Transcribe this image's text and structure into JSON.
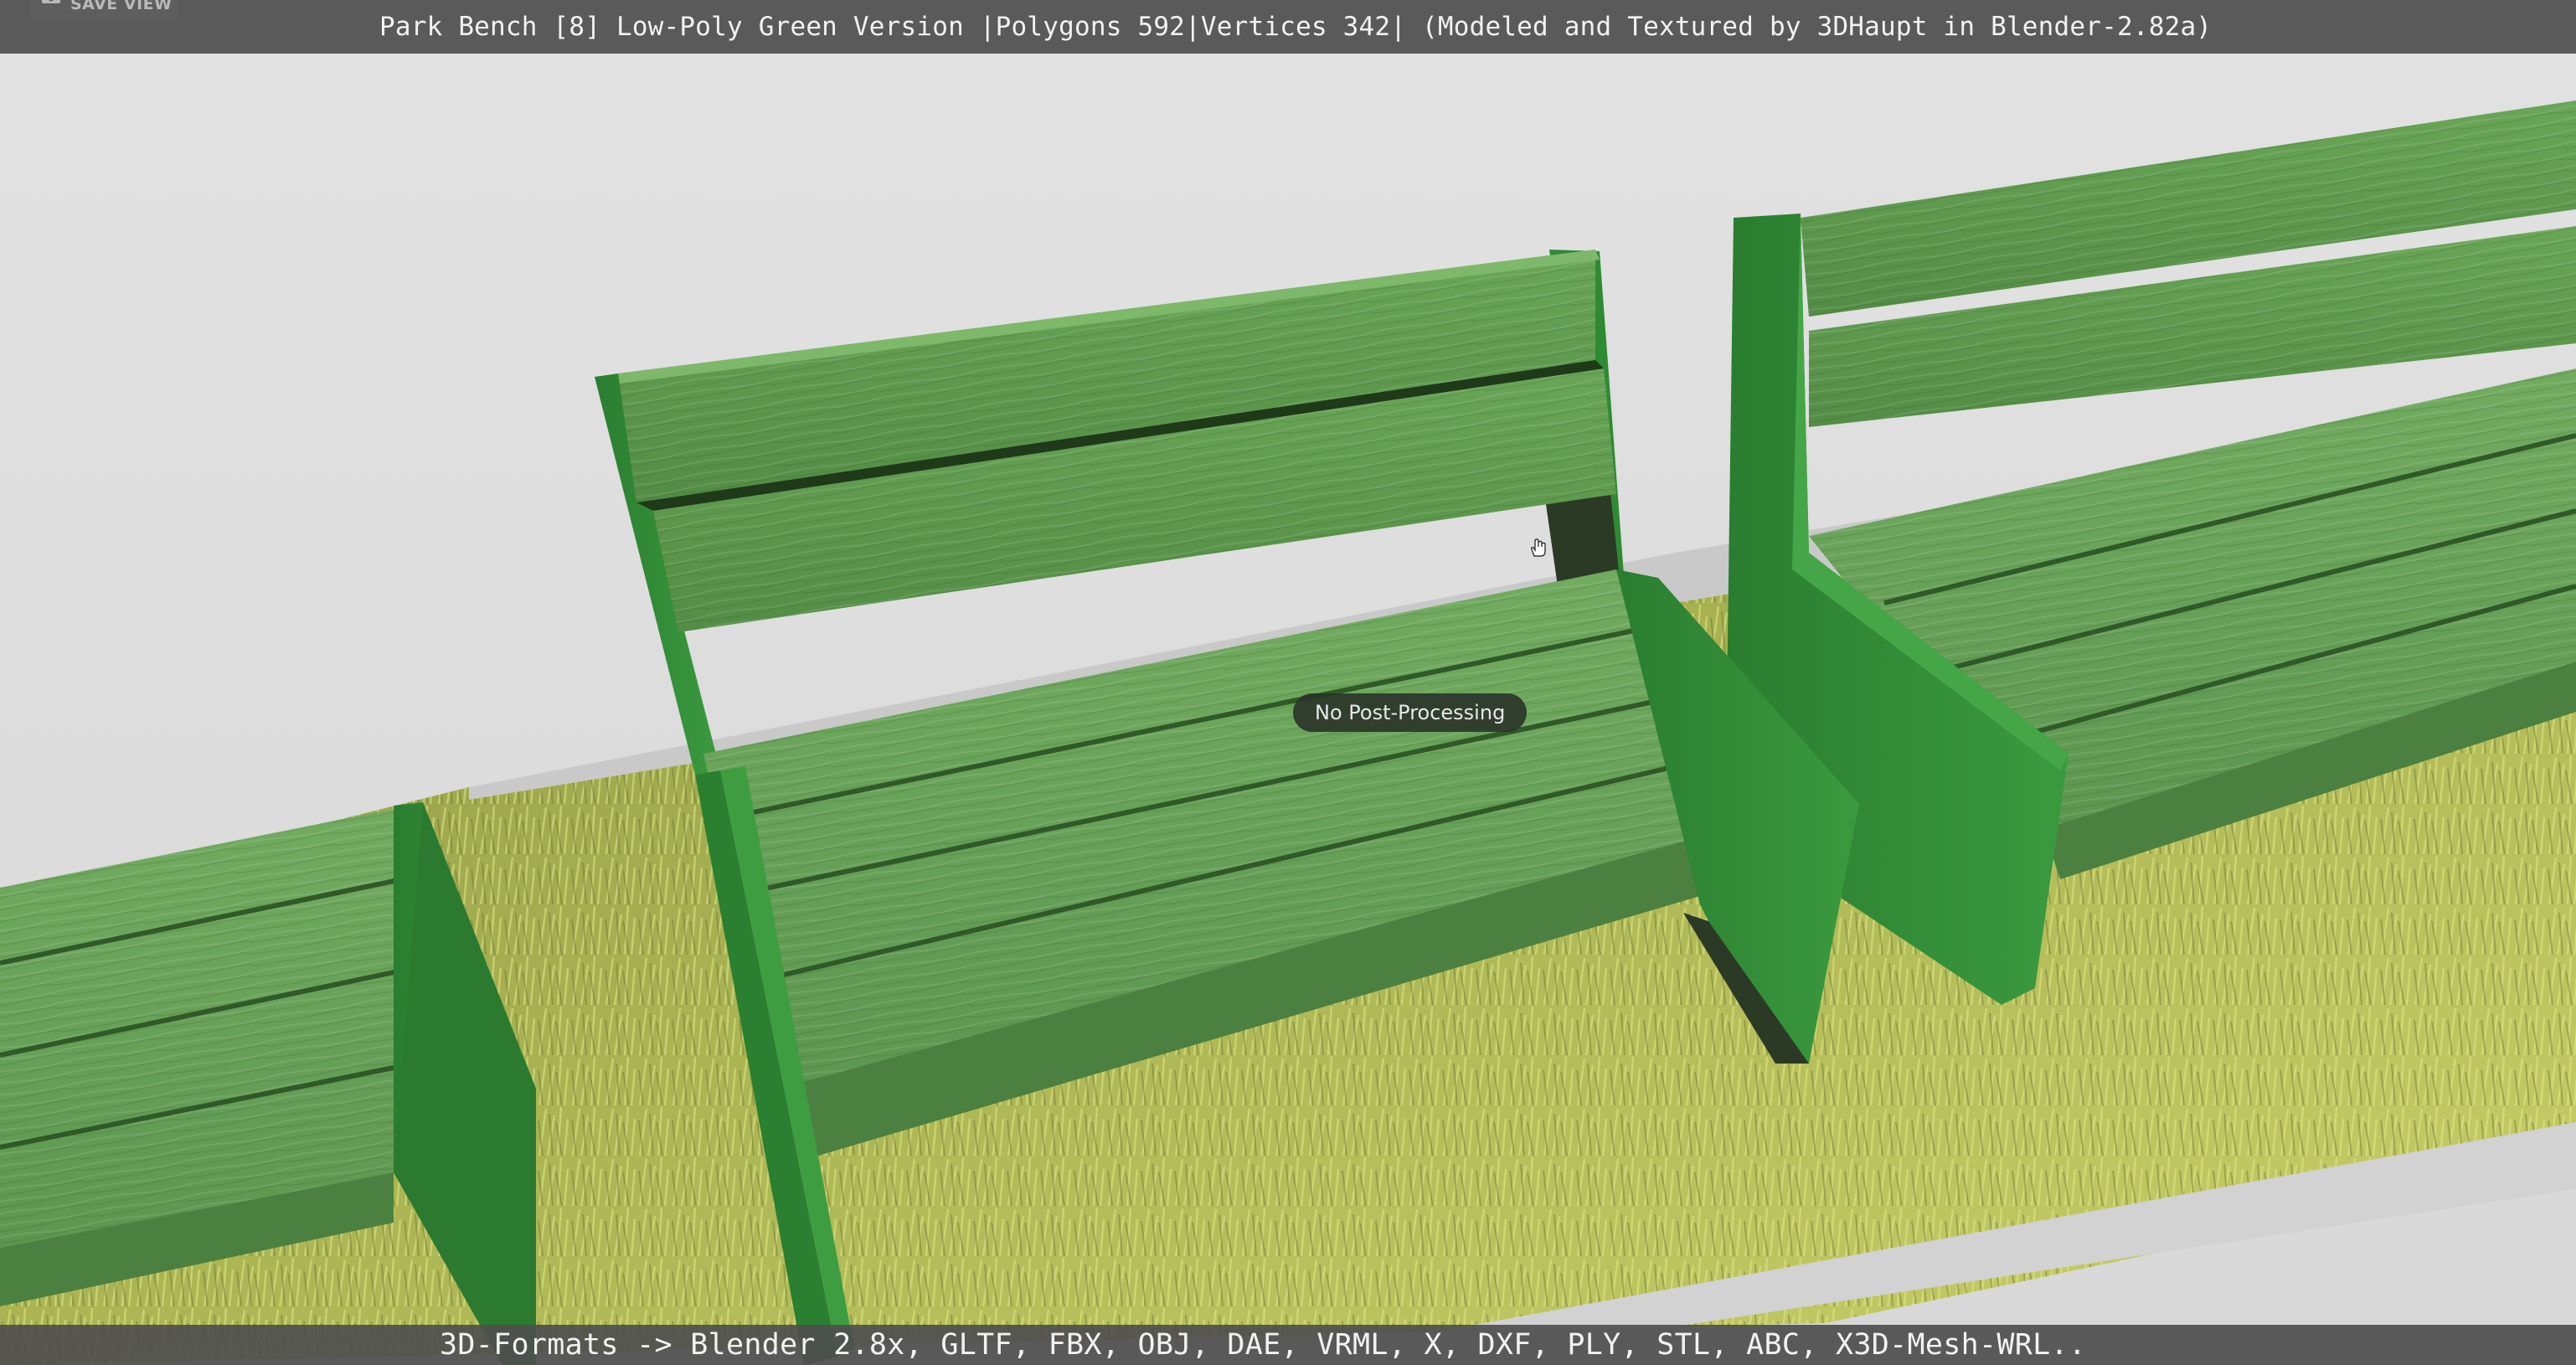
{
  "viewer": {
    "title": "Park Bench [8] Low-Poly Green Version |Polygons 592|Vertices 342| (Modeled and Textured by 3DHaupt in Blender-2.82a)",
    "formats": "3D-Formats -> Blender 2.8x, GLTF, FBX, OBJ, DAE, VRML, X, DXF, PLY, STL, ABC, X3D-Mesh-WRL..",
    "save_view_label": "SAVE VIEW",
    "post_processing_label": "No Post-Processing",
    "save_view_icon": "camera-icon",
    "cursor_icon": "hand-cursor-icon"
  },
  "colors": {
    "background": "#dedede",
    "bench_green": "#5f9a4e",
    "frame_green": "#2f8a34",
    "grass": "#a3ad4e",
    "bar": "#4e4e4e"
  }
}
